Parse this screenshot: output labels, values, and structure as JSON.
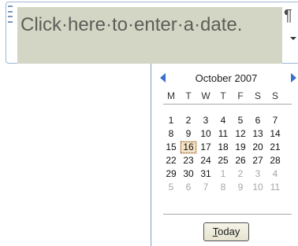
{
  "date_control": {
    "placeholder": "Click·here·to·enter·a·date.",
    "paragraph_mark": "¶"
  },
  "calendar": {
    "month_title": "October 2007",
    "weekdays": [
      "M",
      "T",
      "W",
      "T",
      "F",
      "S",
      "S"
    ],
    "weeks": [
      [
        {
          "d": "1"
        },
        {
          "d": "2"
        },
        {
          "d": "3"
        },
        {
          "d": "4"
        },
        {
          "d": "5"
        },
        {
          "d": "6"
        },
        {
          "d": "7"
        }
      ],
      [
        {
          "d": "8"
        },
        {
          "d": "9"
        },
        {
          "d": "10"
        },
        {
          "d": "11"
        },
        {
          "d": "12"
        },
        {
          "d": "13"
        },
        {
          "d": "14"
        }
      ],
      [
        {
          "d": "15"
        },
        {
          "d": "16",
          "selected": true
        },
        {
          "d": "17"
        },
        {
          "d": "18"
        },
        {
          "d": "19"
        },
        {
          "d": "20"
        },
        {
          "d": "21"
        }
      ],
      [
        {
          "d": "22"
        },
        {
          "d": "23"
        },
        {
          "d": "24"
        },
        {
          "d": "25"
        },
        {
          "d": "26"
        },
        {
          "d": "27"
        },
        {
          "d": "28"
        }
      ],
      [
        {
          "d": "29"
        },
        {
          "d": "30"
        },
        {
          "d": "31"
        },
        {
          "d": "1",
          "other": true
        },
        {
          "d": "2",
          "other": true
        },
        {
          "d": "3",
          "other": true
        },
        {
          "d": "4",
          "other": true
        }
      ],
      [
        {
          "d": "5",
          "other": true
        },
        {
          "d": "6",
          "other": true
        },
        {
          "d": "7",
          "other": true
        },
        {
          "d": "8",
          "other": true
        },
        {
          "d": "9",
          "other": true
        },
        {
          "d": "10",
          "other": true
        },
        {
          "d": "11",
          "other": true
        }
      ]
    ],
    "today_button": {
      "accel": "T",
      "rest": "oday"
    },
    "icons": {
      "prev": "chevron-left-icon",
      "next": "chevron-right-icon",
      "dropdown": "dropdown-arrow-icon"
    },
    "colors": {
      "nav_arrow": "#3a6fcf",
      "placeholder_bg": "#d3d6c4",
      "selected_bg": "#f4e3c7"
    }
  }
}
